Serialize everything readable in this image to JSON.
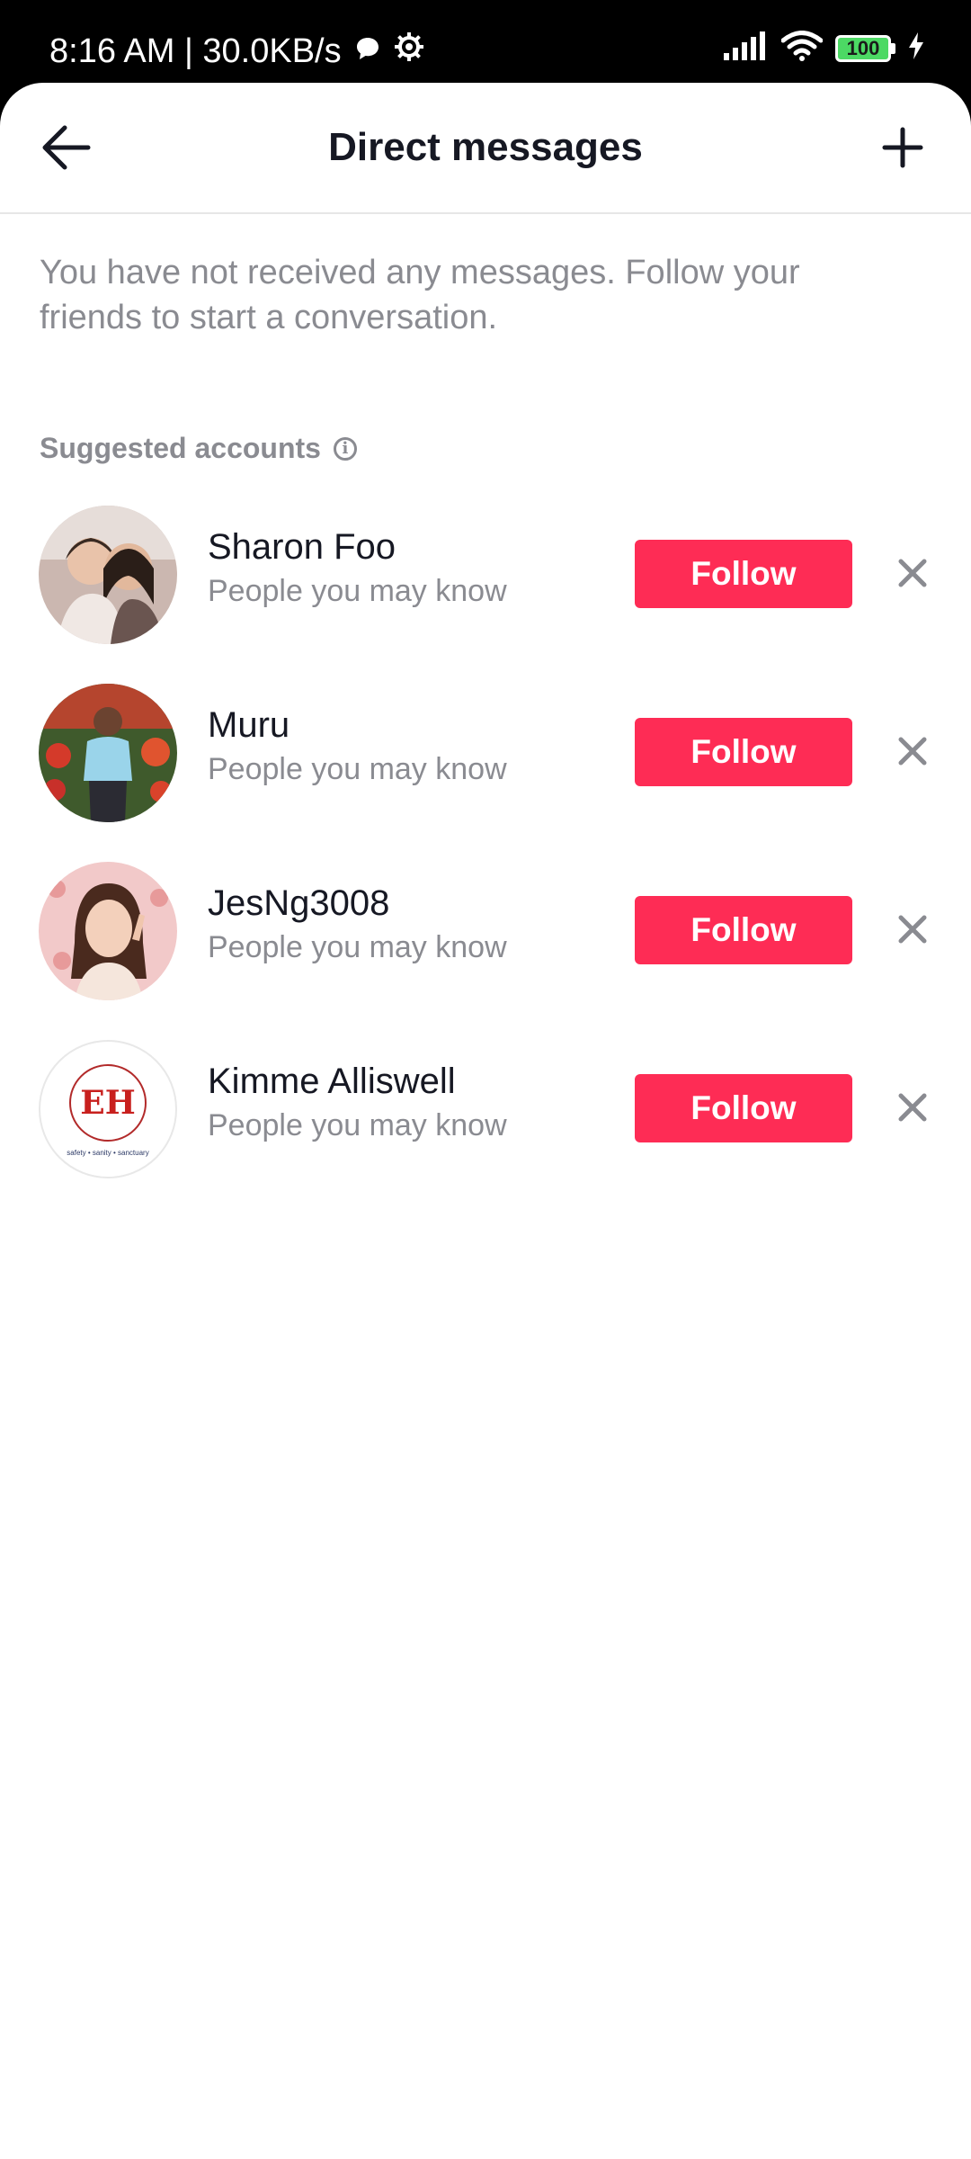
{
  "status_bar": {
    "time_speed": "8:16 AM | 30.0KB/s",
    "battery_level": "100"
  },
  "header": {
    "title": "Direct messages"
  },
  "empty_state": {
    "message": "You have not received any messages. Follow your friends to start a conversation."
  },
  "suggested": {
    "title": "Suggested accounts",
    "accounts": [
      {
        "name": "Sharon Foo",
        "subtitle": "People you may know",
        "follow_label": "Follow"
      },
      {
        "name": "Muru",
        "subtitle": "People you may know",
        "follow_label": "Follow"
      },
      {
        "name": "JesNg3008",
        "subtitle": "People you may know",
        "follow_label": "Follow"
      },
      {
        "name": "Kimme Alliswell",
        "subtitle": "People you may know",
        "follow_label": "Follow"
      }
    ]
  },
  "logo": {
    "letters": "EH",
    "tagline": "safety • sanity • sanctuary"
  },
  "colors": {
    "accent": "#fe2c55",
    "text_primary": "#161823",
    "text_secondary": "#8a8b91"
  }
}
